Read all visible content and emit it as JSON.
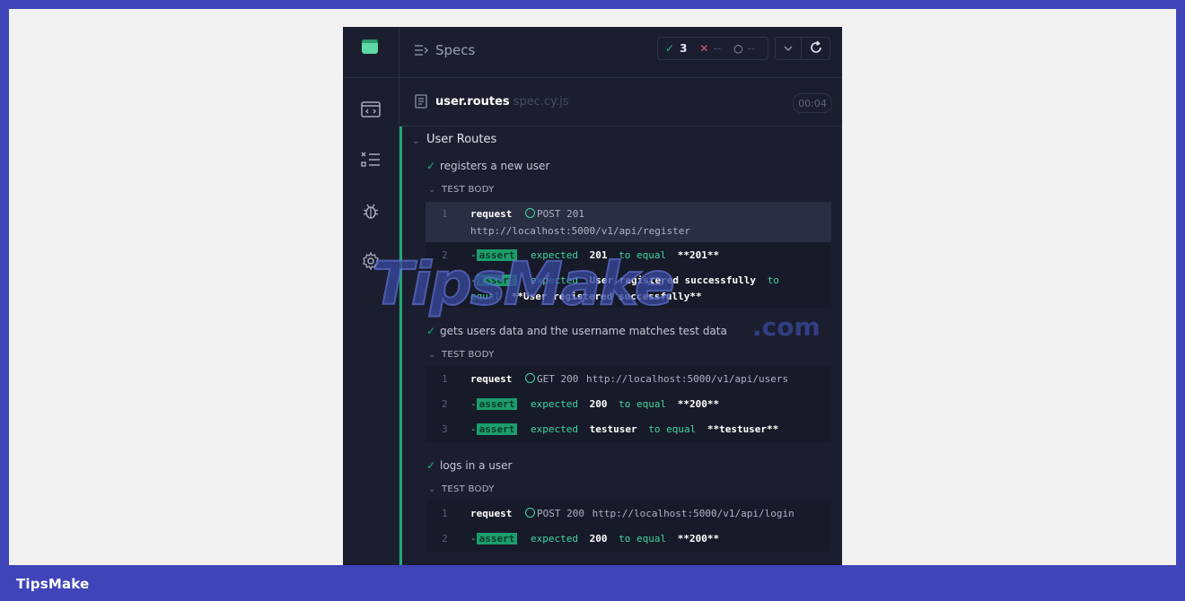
{
  "brand": "TipsMake",
  "watermark": {
    "main": "TipsMake",
    "suffix": ".com"
  },
  "header": {
    "title": "Specs",
    "passed": "3",
    "failed": "--",
    "pending": "--"
  },
  "spec": {
    "name": "user.routes",
    "ext": "spec.cy.js",
    "duration": "00:04"
  },
  "suite": {
    "title": "User Routes"
  },
  "tests": [
    {
      "title": "registers a new user",
      "body_label": "TEST BODY",
      "commands": [
        {
          "num": "1",
          "name": "request",
          "method": "POST 201",
          "url": "http://localhost:5000/v1/api/register"
        },
        {
          "num": "2",
          "tag": "assert",
          "text": [
            "expected",
            "201",
            "to equal",
            "**201**"
          ]
        },
        {
          "num": "3",
          "tag": "assert",
          "text": [
            "expected",
            "User registered successfully",
            "to",
            "equal",
            "**User registered successfully**"
          ]
        }
      ]
    },
    {
      "title": "gets users data and the username matches test data",
      "body_label": "TEST BODY",
      "commands": [
        {
          "num": "1",
          "name": "request",
          "method": "GET 200",
          "url": "http://localhost:5000/v1/api/users"
        },
        {
          "num": "2",
          "tag": "assert",
          "text": [
            "expected",
            "200",
            "to equal",
            "**200**"
          ]
        },
        {
          "num": "3",
          "tag": "assert",
          "text": [
            "expected",
            "testuser",
            "to equal",
            "**testuser**"
          ]
        }
      ]
    },
    {
      "title": "logs in a user",
      "body_label": "TEST BODY",
      "commands": [
        {
          "num": "1",
          "name": "request",
          "method": "POST 200",
          "url": "http://localhost:5000/v1/api/login"
        },
        {
          "num": "2",
          "tag": "assert",
          "text": [
            "expected",
            "200",
            "to equal",
            "**200**"
          ]
        }
      ]
    }
  ],
  "colors": {
    "accent": "#1fa971",
    "panel": "#1b1e2e",
    "frame": "#3f44b8"
  }
}
